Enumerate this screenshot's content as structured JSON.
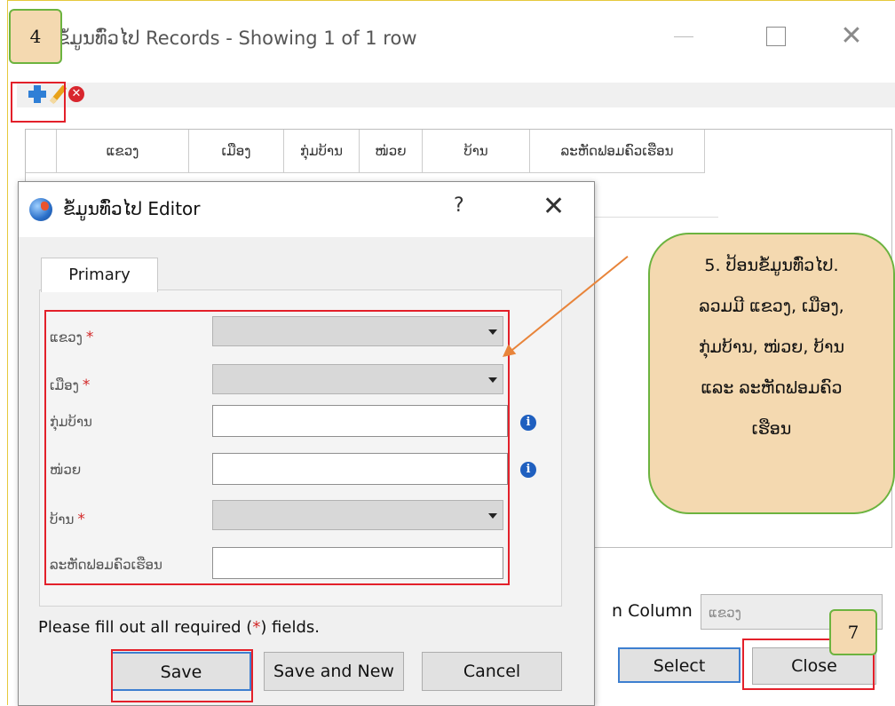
{
  "outer_window": {
    "title": "ຂໍ້ມູນທົ່ວໄປ Records - Showing 1 of 1 row",
    "grid_headers": [
      "ແຂວງ",
      "ເມືອງ",
      "ກຸ່ມບ້ານ",
      "ໜ່ວຍ",
      "ບ້ານ",
      "ລະຫັດຟອມຄົວເຮືອນ"
    ],
    "search_column_label": "n Column",
    "search_column_value": "ແຂວງ",
    "select_button": "Select",
    "close_button": "Close"
  },
  "editor": {
    "title": "ຂໍ້ມູນທົ່ວໄປ Editor",
    "help": "?",
    "close": "✕",
    "tab": "Primary",
    "fields": [
      {
        "label": "ແຂວງ",
        "required": true,
        "type": "combo"
      },
      {
        "label": "ເມືອງ",
        "required": true,
        "type": "combo"
      },
      {
        "label": "ກຸ່ມບ້ານ",
        "required": false,
        "type": "text"
      },
      {
        "label": "ໜ່ວຍ",
        "required": false,
        "type": "text"
      },
      {
        "label": "ບ້ານ",
        "required": true,
        "type": "combo"
      },
      {
        "label": "ລະຫັດຟອມຄົວເຮືອນ",
        "required": false,
        "type": "text"
      }
    ],
    "required_star": "*",
    "info_icon": "i",
    "hint_before": "Please fill out all required (",
    "hint_star": "*",
    "hint_after": ") fields.",
    "save_button": "Save",
    "save_new_button": "Save and New",
    "cancel_button": "Cancel"
  },
  "annotations": {
    "step4": "4",
    "step7": "7",
    "callout_lines": [
      "5. ປ້ອນຂໍ້ມູນທົ່ວໄປ.",
      "ລວມມີ ແຂວງ, ເມືອງ,",
      "ກຸ່ມບ້ານ, ໜ່ວຍ, ບ້ານ",
      "ແລະ ລະຫັດຟອມຄົວ",
      "ເຮືອນ"
    ]
  },
  "colors": {
    "annotation_red": "#e3202a",
    "callout_fill": "#f4d9b0",
    "callout_border": "#6cb33f",
    "accent_blue": "#3d7fd0"
  }
}
